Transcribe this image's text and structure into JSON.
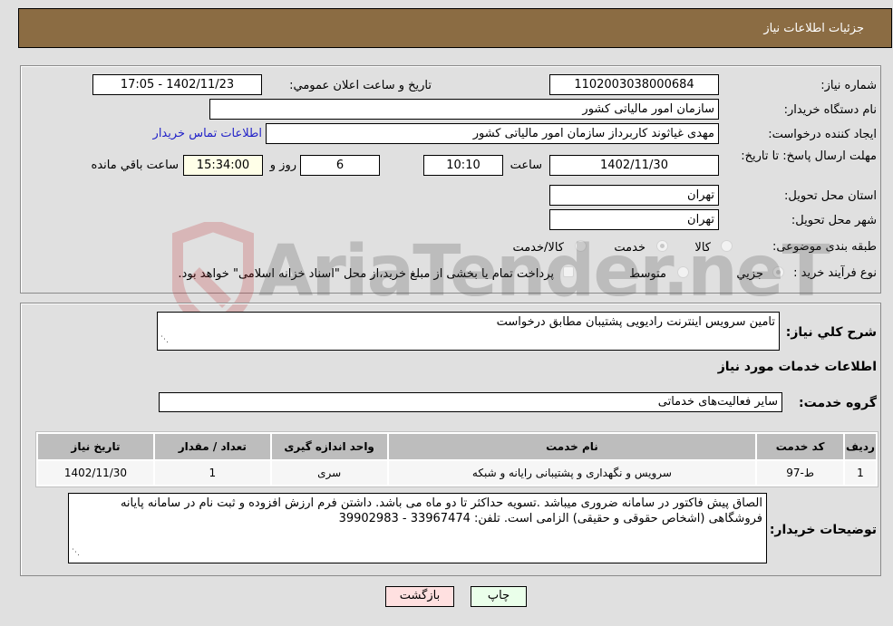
{
  "header": {
    "title": "جزئیات اطلاعات نیاز"
  },
  "fields": {
    "need_number": {
      "label": "شماره نیاز:",
      "value": "1102003038000684"
    },
    "announce_datetime": {
      "label": "تاریخ و ساعت اعلان عمومي:",
      "value": "1402/11/23 - 17:05"
    },
    "buyer_org": {
      "label": "نام دستگاه خریدار:",
      "value": "سازمان امور مالیاتی کشور"
    },
    "requester": {
      "label": "ایجاد کننده درخواست:",
      "value": "مهدی غیاثوند کاربرداز سازمان امور مالیاتی کشور"
    },
    "buyer_contact_link": "اطلاعات تماس خریدار",
    "deadline": {
      "label": "مهلت ارسال پاسخ: تا تاریخ:",
      "date": "1402/11/30",
      "time_label": "ساعت",
      "time": "10:10",
      "days": "6",
      "days_label": "روز و",
      "remaining": "15:34:00",
      "remaining_label": "ساعت باقي مانده"
    },
    "province": {
      "label": "استان محل تحویل:",
      "value": "تهران"
    },
    "city": {
      "label": "شهر محل تحویل:",
      "value": "تهران"
    },
    "category": {
      "label": "طبقه بندی موضوعی:",
      "options": [
        "کالا",
        "خدمت",
        "کالا/خدمت"
      ],
      "selected": "خدمت"
    },
    "purchase_type": {
      "label": "نوع فرآیند خرید :",
      "options": [
        "جزیي",
        "متوسط"
      ],
      "selected": "جزیي",
      "treasury_note": "پرداخت تمام یا بخشی از مبلغ خرید،از محل \"اسناد خزانه اسلامی\" خواهد بود."
    }
  },
  "description": {
    "label": "شرح کلي نیاز:",
    "value": "تامین سرویس اینترنت رادیویی پشتیبان مطابق درخواست"
  },
  "services_section": {
    "title": "اطلاعات خدمات مورد نیاز",
    "group_label": "گروه خدمت:",
    "group_value": "سایر فعالیت‌های خدماتی"
  },
  "table": {
    "headers": [
      "ردیف",
      "کد خدمت",
      "نام خدمت",
      "واحد اندازه گیری",
      "تعداد / مقدار",
      "تاریخ نیاز"
    ],
    "rows": [
      [
        "1",
        "ط-97",
        "سرویس و نگهداری و پشتیبانی رایانه و شبکه",
        "سری",
        "1",
        "1402/11/30"
      ]
    ]
  },
  "buyer_notes": {
    "label": "توضیحات خریدار:",
    "value": "الصاق پیش فاکتور در سامانه ضروری میباشد .تسویه حداکثر تا دو ماه می باشد.  داشتن فرم ارزش افزوده و ثبت نام در سامانه پایانه فروشگاهی (اشخاص حقوقی و حقیقی) الزامی است. تلفن: 33967474 - 39902983"
  },
  "buttons": {
    "print": "چاپ",
    "back": "بازگشت"
  },
  "watermark": "AriaTender.neT",
  "colors": {
    "header_bg": "#8b6c43",
    "link": "#2323c8",
    "back_bg": "#ffe0e0",
    "print_bg": "#eaffea",
    "remaining_bg": "#ffffe8"
  }
}
